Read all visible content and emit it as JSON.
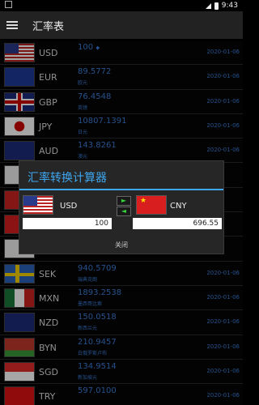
{
  "status": {
    "time": "9:43"
  },
  "appbar": {
    "title": "汇率表",
    "menu_icon": "menu-icon"
  },
  "rows": [
    {
      "code": "USD",
      "rate": "100",
      "name": "",
      "date": "2020-01-06",
      "flag": "us-flag-icon"
    },
    {
      "code": "EUR",
      "rate": "89.5772",
      "name": "欧元",
      "date": "2020-01-06",
      "flag": "eu-flag-icon"
    },
    {
      "code": "GBP",
      "rate": "76.4548",
      "name": "英镑",
      "date": "2020-01-06",
      "flag": "gb-flag-icon"
    },
    {
      "code": "JPY",
      "rate": "10807.1391",
      "name": "日元",
      "date": "2020-01-06",
      "flag": "jp-flag-icon"
    },
    {
      "code": "AUD",
      "rate": "143.8261",
      "name": "澳元",
      "date": "2020-01-06",
      "flag": "au-flag-icon"
    },
    {
      "code": "SEK",
      "rate": "940.5709",
      "name": "瑞典克朗",
      "date": "2020-01-06",
      "flag": "se-flag-icon"
    },
    {
      "code": "MXN",
      "rate": "1893.2538",
      "name": "墨西哥比索",
      "date": "2020-01-06",
      "flag": "mx-flag-icon"
    },
    {
      "code": "NZD",
      "rate": "150.0518",
      "name": "新西兰元",
      "date": "2020-01-06",
      "flag": "nz-flag-icon"
    },
    {
      "code": "BYN",
      "rate": "210.9457",
      "name": "白俄罗斯卢布",
      "date": "2020-01-06",
      "flag": "by-flag-icon"
    },
    {
      "code": "SGD",
      "rate": "134.9514",
      "name": "新加坡元",
      "date": "2020-01-06",
      "flag": "sg-flag-icon"
    },
    {
      "code": "TRY",
      "rate": "597.0100",
      "name": "",
      "date": "2020-01-06",
      "flag": "tr-flag-icon"
    }
  ],
  "dialog": {
    "title": "汇率转换计算器",
    "from_code": "USD",
    "to_code": "CNY",
    "from_amount": "100",
    "to_amount": "696.55",
    "arrow_right": "►",
    "arrow_left": "◄",
    "close_label": "关闭"
  }
}
